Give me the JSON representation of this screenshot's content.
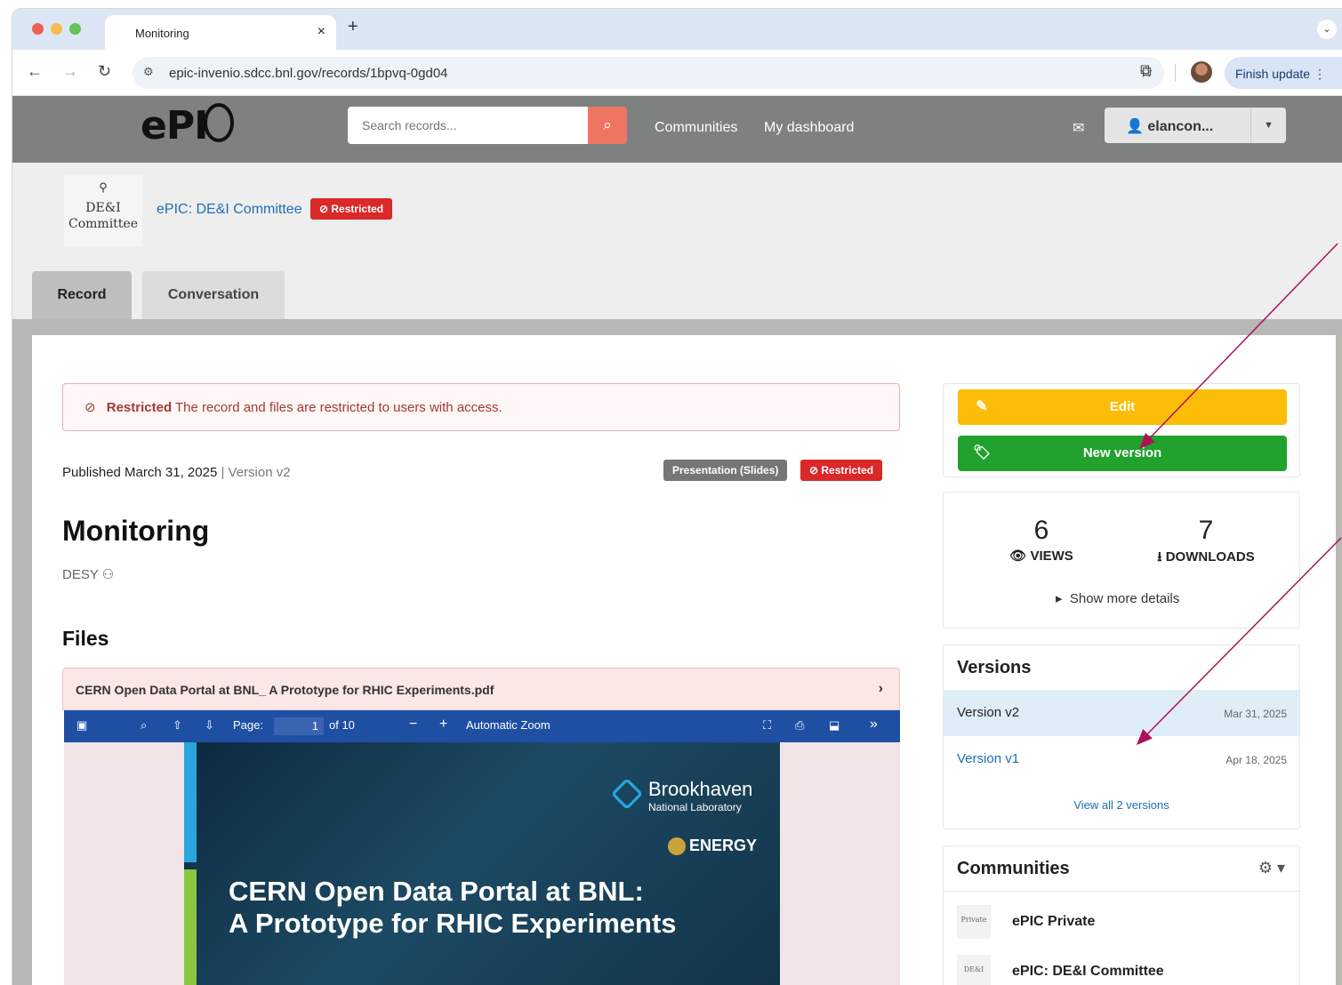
{
  "browser": {
    "tab_title": "Monitoring",
    "tab_close": "×",
    "new_tab": "+",
    "tab_menu": "⌄",
    "url": "epic-invenio.sdcc.bnl.gov/records/1bpvq-0gd04",
    "finish_update": "Finish update",
    "colors": {
      "close": "#ee5f57",
      "minimize": "#f5bd4f",
      "maximize": "#61c454"
    }
  },
  "header": {
    "logo_text": "ePI",
    "search_placeholder": "Search records...",
    "links": [
      "Communities",
      "My dashboard"
    ],
    "username": "elancon..."
  },
  "community": {
    "logo_line1": "DE&I",
    "logo_line2": "Committee",
    "name": "ePIC: DE&I Committee",
    "badge": "Restricted"
  },
  "tabs": [
    "Record",
    "Conversation"
  ],
  "record": {
    "alert_title": "Restricted",
    "alert_text": "The record and files are restricted to users with access.",
    "published": "Published March 31, 2025",
    "version": "| Version v2",
    "type_badge": "Presentation (Slides)",
    "access_badge": "Restricted",
    "title": "Monitoring",
    "creator": "DESY",
    "files_header": "Files",
    "file_name": "CERN Open Data Portal at BNL_ A Prototype for RHIC Experiments.pdf",
    "pdf_toolbar": {
      "page_label": "Page:",
      "page_value": "1",
      "page_total": "of 10",
      "zoom": "Automatic Zoom"
    },
    "slide": {
      "org_name": "Brookhaven",
      "org_sub": "National Laboratory",
      "doe": "ENERGY",
      "title_line1": "CERN Open Data Portal at BNL:",
      "title_line2": "A Prototype for RHIC Experiments"
    }
  },
  "sidebar": {
    "edit_label": "Edit",
    "new_version_label": "New version",
    "views_count": "6",
    "views_label": "VIEWS",
    "downloads_count": "7",
    "downloads_label": "DOWNLOADS",
    "more_details": "Show more details",
    "versions_header": "Versions",
    "versions": [
      {
        "label": "Version v2",
        "date": "Mar 31, 2025"
      },
      {
        "label": "Version v1",
        "date": "Apr 18, 2025"
      }
    ],
    "view_all": "View all 2 versions",
    "communities_header": "Communities",
    "communities": [
      {
        "name": "ePIC Private",
        "thumb": "Private"
      },
      {
        "name": "ePIC: DE&I Committee",
        "thumb": "DE&I"
      }
    ]
  },
  "colors": {
    "accent_red": "#db2828",
    "edit_yellow": "#fbbd08",
    "new_version_green": "#21a12e",
    "pdf_toolbar_blue": "#1f4fa3",
    "annotation_arrow": "#b0105a"
  }
}
